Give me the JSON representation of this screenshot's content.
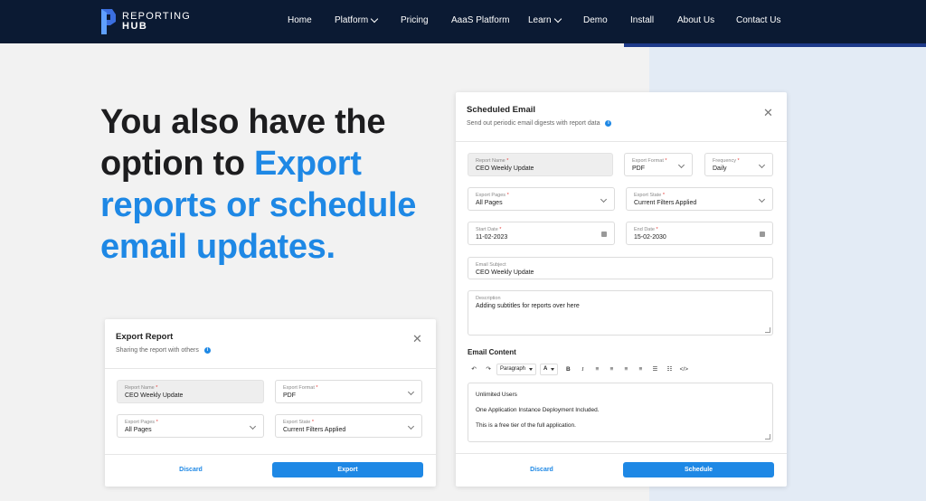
{
  "nav": {
    "logo_line1": "REPORTING",
    "logo_line2": "HUB",
    "links": [
      {
        "label": "Home"
      },
      {
        "label": "Platform"
      },
      {
        "label": "Pricing"
      },
      {
        "label": "AaaS Platform"
      },
      {
        "label": "Learn"
      },
      {
        "label": "Demo"
      },
      {
        "label": "Install"
      },
      {
        "label": "About Us"
      },
      {
        "label": "Contact Us"
      }
    ]
  },
  "headline": {
    "part1": "You also have the option to ",
    "part2": "Export reports or schedule email updates."
  },
  "export_card": {
    "title": "Export Report",
    "subtitle": "Sharing the report with others",
    "fields": {
      "report_name": {
        "label": "Report Name",
        "value": "CEO Weekly Update"
      },
      "export_format": {
        "label": "Export Format",
        "value": "PDF"
      },
      "export_pages": {
        "label": "Export Pages",
        "value": "All Pages"
      },
      "export_state": {
        "label": "Export State",
        "value": "Current Filters Applied"
      }
    },
    "discard_label": "Discard",
    "export_label": "Export"
  },
  "schedule_card": {
    "title": "Scheduled Email",
    "subtitle": "Send out periodic email digests  with report data",
    "fields": {
      "report_name": {
        "label": "Report Name",
        "value": "CEO Weekly Update"
      },
      "export_format": {
        "label": "Export Format",
        "value": "PDF"
      },
      "frequency": {
        "label": "Frequency",
        "value": "Daily"
      },
      "export_pages": {
        "label": "Export Pages",
        "value": "All Pages"
      },
      "export_state": {
        "label": "Export State",
        "value": "Current Filters Applied"
      },
      "start_date": {
        "label": "Start Date",
        "value": "11-02-2023"
      },
      "end_date": {
        "label": "End Date",
        "value": "15-02-2030"
      },
      "email_subject": {
        "label": "Email Subject",
        "value": "CEO Weekly Update"
      },
      "description": {
        "label": "Description",
        "value": "Adding subtitles for reports over here"
      }
    },
    "email_content_label": "Email Content",
    "toolbar": {
      "undo": "↶",
      "redo": "↷",
      "paragraph": "Paragraph",
      "font_color": "A",
      "bold": "B",
      "italic": "I",
      "align_left": "≡",
      "align_center": "≡",
      "align_right": "≡",
      "align_justify": "≡",
      "list_bullet": "☰",
      "list_number": "☷",
      "code": "</>"
    },
    "editor_lines": [
      "Unlimited Users",
      "One Application Instance Deployment Included.",
      "This is a free tier of the full application."
    ],
    "discard_label": "Discard",
    "schedule_label": "Schedule"
  },
  "colors": {
    "nav_bg": "#0b1a33",
    "accent": "#1e88e5",
    "required": "#e53935"
  }
}
